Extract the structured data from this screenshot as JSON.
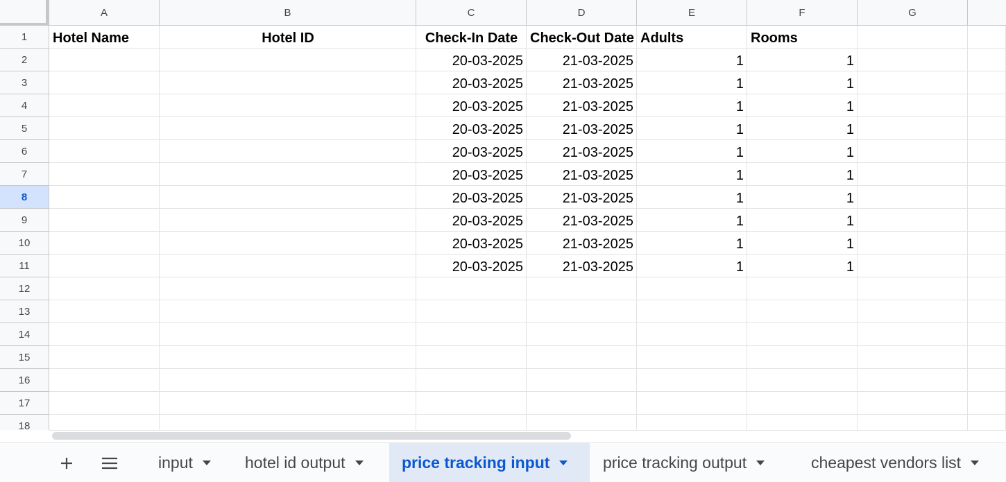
{
  "spreadsheet": {
    "columns": [
      "A",
      "B",
      "C",
      "D",
      "E",
      "F",
      "G"
    ],
    "row_numbers": [
      "1",
      "2",
      "3",
      "4",
      "5",
      "6",
      "7",
      "8",
      "9",
      "10",
      "11",
      "12",
      "13",
      "14",
      "15",
      "16",
      "17",
      "18"
    ],
    "selected_row": "8",
    "header_row": [
      "Hotel Name",
      "Hotel ID",
      "Check-In Date",
      "Check-Out Date",
      "Adults",
      "Rooms",
      ""
    ],
    "data_rows": [
      [
        "",
        "",
        "20-03-2025",
        "21-03-2025",
        "1",
        "1",
        ""
      ],
      [
        "",
        "",
        "20-03-2025",
        "21-03-2025",
        "1",
        "1",
        ""
      ],
      [
        "",
        "",
        "20-03-2025",
        "21-03-2025",
        "1",
        "1",
        ""
      ],
      [
        "",
        "",
        "20-03-2025",
        "21-03-2025",
        "1",
        "1",
        ""
      ],
      [
        "",
        "",
        "20-03-2025",
        "21-03-2025",
        "1",
        "1",
        ""
      ],
      [
        "",
        "",
        "20-03-2025",
        "21-03-2025",
        "1",
        "1",
        ""
      ],
      [
        "",
        "",
        "20-03-2025",
        "21-03-2025",
        "1",
        "1",
        ""
      ],
      [
        "",
        "",
        "20-03-2025",
        "21-03-2025",
        "1",
        "1",
        ""
      ],
      [
        "",
        "",
        "20-03-2025",
        "21-03-2025",
        "1",
        "1",
        ""
      ],
      [
        "",
        "",
        "20-03-2025",
        "21-03-2025",
        "1",
        "1",
        ""
      ]
    ]
  },
  "sheet_bar": {
    "add_sheet_icon": "plus-icon",
    "all_sheets_icon": "menu-icon",
    "tabs": [
      {
        "label": "input",
        "active": false
      },
      {
        "label": "hotel id output",
        "active": false
      },
      {
        "label": "price tracking input",
        "active": true
      },
      {
        "label": "price tracking output",
        "active": false
      },
      {
        "label": "cheapest vendors list",
        "active": false
      }
    ]
  },
  "colors": {
    "accent": "#0b57d0",
    "active_tab_bg": "#e1e9f7",
    "selected_row_header_bg": "#d3e3fd"
  }
}
